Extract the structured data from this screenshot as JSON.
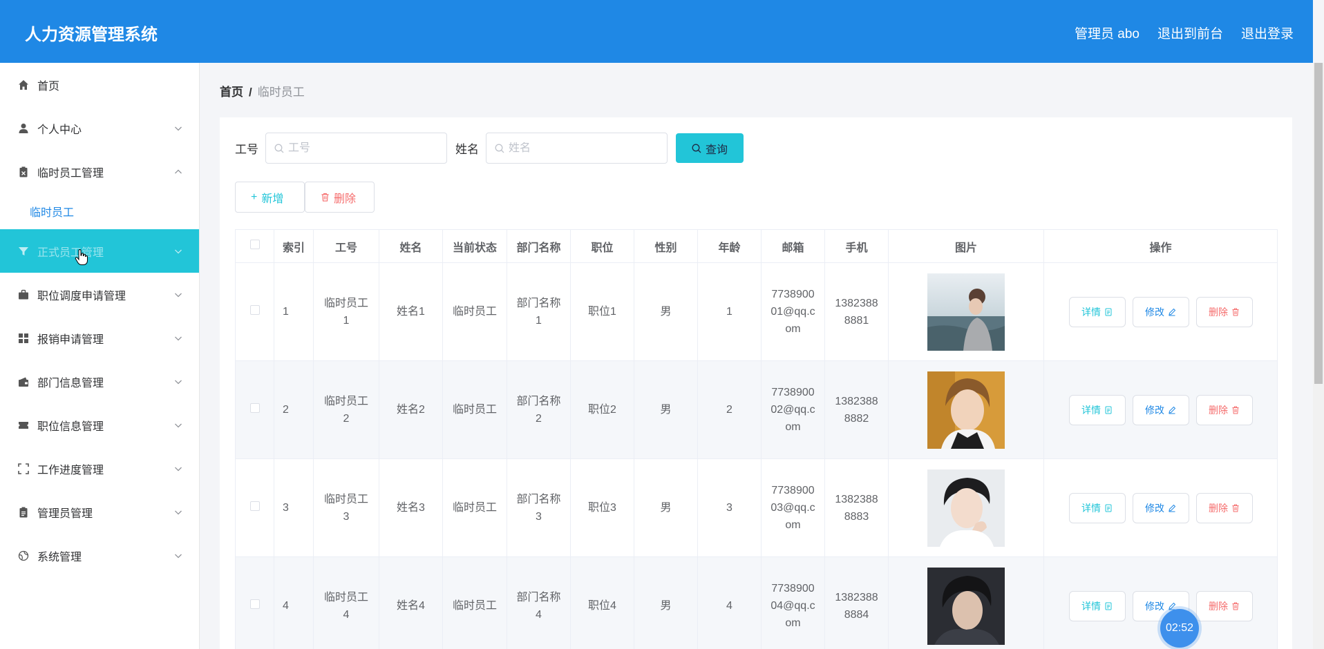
{
  "header": {
    "title": "人力资源管理系统",
    "nav": [
      "管理员 abo",
      "退出到前台",
      "退出登录"
    ]
  },
  "sidebar": {
    "items": [
      {
        "label": "首页",
        "icon": "home-icon"
      },
      {
        "label": "个人中心",
        "icon": "user-icon"
      },
      {
        "label": "临时员工管理",
        "icon": "clipboard-icon"
      },
      {
        "label": "正式员工管理",
        "icon": "filter-icon"
      },
      {
        "label": "职位调度申请管理",
        "icon": "briefcase-icon"
      },
      {
        "label": "报销申请管理",
        "icon": "grid-icon"
      },
      {
        "label": "部门信息管理",
        "icon": "wallet-icon"
      },
      {
        "label": "职位信息管理",
        "icon": "ticket-icon"
      },
      {
        "label": "工作进度管理",
        "icon": "fullscreen-icon"
      },
      {
        "label": "管理员管理",
        "icon": "document-icon"
      },
      {
        "label": "系统管理",
        "icon": "globe-icon"
      }
    ],
    "subitem": "临时员工"
  },
  "breadcrumb": {
    "home": "首页",
    "sep": "/",
    "current": "临时员工"
  },
  "search": {
    "id_label": "工号",
    "id_placeholder": "工号",
    "name_label": "姓名",
    "name_placeholder": "姓名",
    "query_label": "查询"
  },
  "actions": {
    "add_label": "新增",
    "delete_label": "删除"
  },
  "table": {
    "headers": [
      "索引",
      "工号",
      "姓名",
      "当前状态",
      "部门名称",
      "职位",
      "性别",
      "年龄",
      "邮箱",
      "手机",
      "图片",
      "操作"
    ],
    "rows": [
      {
        "index": "1",
        "id": "临时员工\n1",
        "name": "姓名1",
        "status": "临时员工",
        "dept": "部门名称\n1",
        "position": "职位1",
        "gender": "男",
        "age": "1",
        "email": "7738900\n01@qq.c\nom",
        "phone": "1382388\n8881"
      },
      {
        "index": "2",
        "id": "临时员工\n2",
        "name": "姓名2",
        "status": "临时员工",
        "dept": "部门名称\n2",
        "position": "职位2",
        "gender": "男",
        "age": "2",
        "email": "7738900\n02@qq.c\nom",
        "phone": "1382388\n8882"
      },
      {
        "index": "3",
        "id": "临时员工\n3",
        "name": "姓名3",
        "status": "临时员工",
        "dept": "部门名称\n3",
        "position": "职位3",
        "gender": "男",
        "age": "3",
        "email": "7738900\n03@qq.c\nom",
        "phone": "1382388\n8883"
      },
      {
        "index": "4",
        "id": "临时员工\n4",
        "name": "姓名4",
        "status": "临时员工",
        "dept": "部门名称\n4",
        "position": "职位4",
        "gender": "男",
        "age": "4",
        "email": "7738900\n04@qq.c\nom",
        "phone": "1382388\n8884"
      }
    ],
    "ops": {
      "detail": "详情",
      "edit": "修改",
      "delete": "删除"
    }
  },
  "timer": "02:52",
  "colors": {
    "primary": "#1f88e5",
    "accent": "#22c5d8",
    "danger": "#f56c6c"
  }
}
